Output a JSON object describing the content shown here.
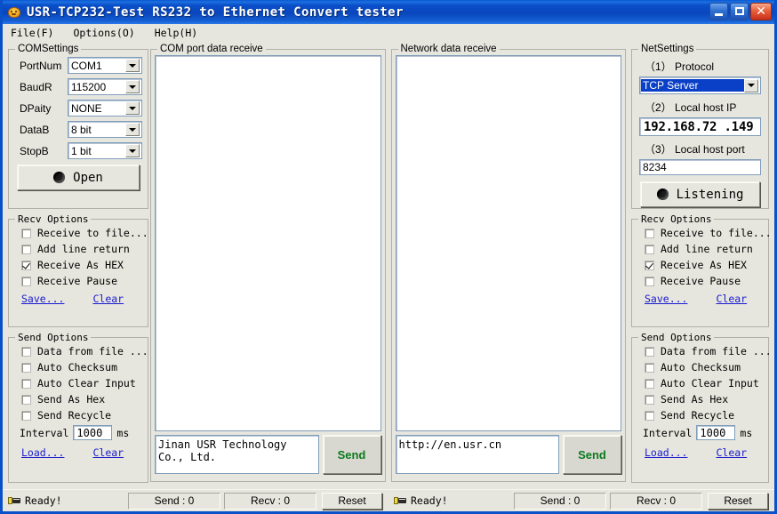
{
  "window": {
    "title": "USR-TCP232-Test   RS232 to Ethernet Convert tester",
    "icon": "app-icon",
    "minimize_label": "_",
    "maximize_label": "□",
    "close_label": "✕"
  },
  "menu": {
    "items": [
      {
        "label": "File(F)"
      },
      {
        "label": "Options(O)"
      },
      {
        "label": "Help(H)"
      }
    ]
  },
  "com_settings": {
    "title": "COMSettings",
    "rows": [
      {
        "label": "PortNum",
        "value": "COM1"
      },
      {
        "label": "BaudR",
        "value": "115200"
      },
      {
        "label": "DPaity",
        "value": "NONE"
      },
      {
        "label": "DataB",
        "value": "8 bit"
      },
      {
        "label": "StopB",
        "value": "1 bit"
      }
    ],
    "open_button": "Open"
  },
  "left_recv_options": {
    "title": "Recv Options",
    "checkboxes": [
      {
        "label": "Receive to file...",
        "checked": false
      },
      {
        "label": "Add line return",
        "checked": false
      },
      {
        "label": "Receive As HEX",
        "checked": true
      },
      {
        "label": "Receive Pause",
        "checked": false
      }
    ],
    "save_link": "Save...",
    "clear_link": "Clear"
  },
  "left_send_options": {
    "title": "Send Options",
    "checkboxes": [
      {
        "label": "Data from file ...",
        "checked": false
      },
      {
        "label": "Auto Checksum",
        "checked": false
      },
      {
        "label": "Auto Clear Input",
        "checked": false
      },
      {
        "label": "Send As Hex",
        "checked": false
      },
      {
        "label": "Send Recycle",
        "checked": false
      }
    ],
    "interval_label": "Interval",
    "interval_value": "1000",
    "interval_unit": "ms",
    "load_link": "Load...",
    "clear_link": "Clear"
  },
  "com_panel": {
    "title": "COM port data receive",
    "received_text": "",
    "send_value": "Jinan USR Technology Co., Ltd.",
    "send_button": "Send"
  },
  "net_panel": {
    "title": "Network data receive",
    "received_text": "",
    "send_value": "http://en.usr.cn",
    "send_button": "Send"
  },
  "net_settings": {
    "title": "NetSettings",
    "protocol_label": "（1） Protocol",
    "protocol_value": "TCP Server",
    "host_ip_label": "（2） Local host IP",
    "host_ip_value": "192.168.72 .149",
    "host_port_label": "（3） Local host port",
    "host_port_value": "8234",
    "listening_button": "Listening"
  },
  "right_recv_options": {
    "title": "Recv Options",
    "checkboxes": [
      {
        "label": "Receive to file...",
        "checked": false
      },
      {
        "label": "Add line return",
        "checked": false
      },
      {
        "label": "Receive As HEX",
        "checked": true
      },
      {
        "label": "Receive Pause",
        "checked": false
      }
    ],
    "save_link": "Save...",
    "clear_link": "Clear"
  },
  "right_send_options": {
    "title": "Send Options",
    "checkboxes": [
      {
        "label": "Data from file ...",
        "checked": false
      },
      {
        "label": "Auto Checksum",
        "checked": false
      },
      {
        "label": "Auto Clear Input",
        "checked": false
      },
      {
        "label": "Send As Hex",
        "checked": false
      },
      {
        "label": "Send Recycle",
        "checked": false
      }
    ],
    "interval_label": "Interval",
    "interval_value": "1000",
    "interval_unit": "ms",
    "load_link": "Load...",
    "clear_link": "Clear"
  },
  "status_left": {
    "ready": "Ready!",
    "send_count": "Send : 0",
    "recv_count": "Recv : 0",
    "reset_label": "Reset"
  },
  "status_right": {
    "ready": "Ready!",
    "send_count": "Send : 0",
    "recv_count": "Recv : 0",
    "reset_label": "Reset"
  },
  "colors": {
    "titlebar": "#0a4fc8",
    "window_bg": "#e6e6de",
    "link": "#1a1ad0",
    "send_button_text": "#0c7a1e",
    "selection": "#0a3fc8"
  }
}
